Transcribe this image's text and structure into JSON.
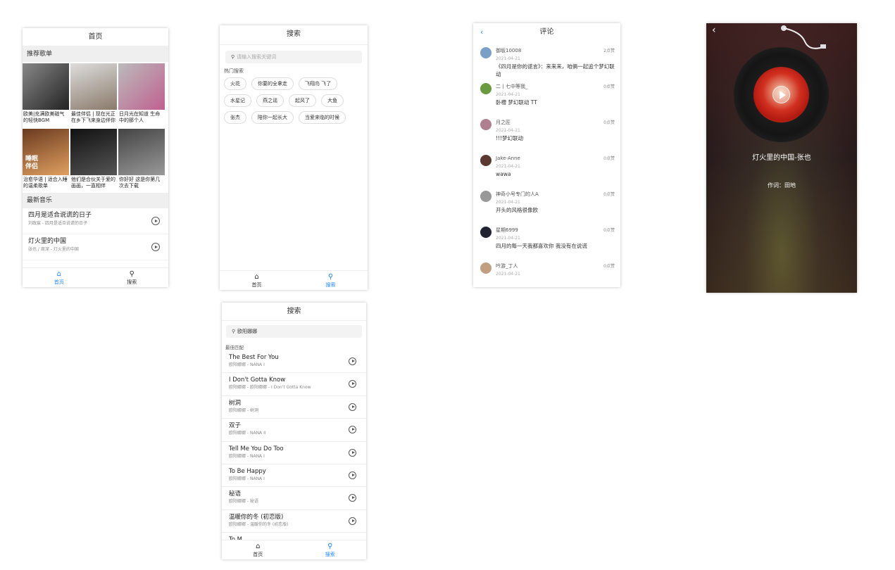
{
  "home": {
    "title": "首页",
    "rec_section": "推荐歌单",
    "playlists": [
      {
        "title": "欧美|充满欧美磁气的轻快BGM",
        "bg": "linear-gradient(135deg,#888,#222)"
      },
      {
        "title": "最佳伴侣 | 现在光正在乡下飞来身边伴你",
        "bg": "linear-gradient(160deg,#ddd,#8a7a6a)"
      },
      {
        "title": "日月光在知道 生命中的那个人",
        "bg": "linear-gradient(135deg,#bbb,#c06090)"
      },
      {
        "title": "治愈华语 | 适合入睡的温柔歌单",
        "bg": "linear-gradient(160deg,#6a3a20,#e0a060)",
        "overlay": "睡眠\n伴侣"
      },
      {
        "title": "他们是合伙关于爱的画画，一直相伴",
        "bg": "linear-gradient(160deg,#111,#555)"
      },
      {
        "title": "你好好 这是你第几次去下载",
        "bg": "linear-gradient(160deg,#444,#999)"
      }
    ],
    "latest_section": "最新音乐",
    "songs": [
      {
        "title": "四月是适合说谎的日子",
        "sub": "刘政宸 - 四月是适合说谎的日子"
      },
      {
        "title": "灯火里的中国",
        "sub": "张也 / 周深 - 灯火里的中国"
      }
    ]
  },
  "tabs": {
    "home": "首页",
    "search": "搜索"
  },
  "search": {
    "title": "搜索",
    "placeholder": "请输入搜索关键词",
    "hot_label": "热门搜索",
    "hot_words": [
      "火花",
      "你要的全拿走",
      "飞翔鸟 飞了",
      "水星记",
      "燕之谣",
      "起风了",
      "大鱼",
      "张杰",
      "陪你一起长大",
      "当爱来临的时候"
    ]
  },
  "comments": {
    "title": "评论",
    "items": [
      {
        "name": "御坂10008",
        "likes": "2点赞",
        "date": "2021-04-21",
        "text": "《四月是你的谎言》：来来来，咱俩一起追个梦幻联动",
        "color": "#7aa0c8"
      },
      {
        "name": "二丨七中等我_",
        "likes": "0点赞",
        "date": "2021-04-21",
        "text": "卧槽 梦幻联动 TT",
        "color": "#6a9a40"
      },
      {
        "name": "月之匠",
        "likes": "0点赞",
        "date": "2021-04-21",
        "text": "!!!梦幻联动",
        "color": "#b08090"
      },
      {
        "name": "Jake-Anne",
        "likes": "0点赞",
        "date": "2021-04-21",
        "text": "wawa",
        "color": "#5a3a30"
      },
      {
        "name": "神奇小号专门的人A",
        "likes": "0点赞",
        "date": "2021-04-21",
        "text": "开头的风格很像欧",
        "color": "#999"
      },
      {
        "name": "星期6999",
        "likes": "0点赞",
        "date": "2021-04-21",
        "text": "四月的每一天我都喜欢你 我没有在说谎",
        "color": "#223"
      },
      {
        "name": "吟游_丁人",
        "likes": "0点赞",
        "date": "2021-04-21",
        "text": "",
        "color": "#c0a080"
      }
    ]
  },
  "player": {
    "song_title": "灯火里的中国-张也",
    "lyric": "作词：田地"
  },
  "search_results": {
    "title": "搜索",
    "query": "欧阳娜娜",
    "best_label": "最佳匹配",
    "items": [
      {
        "title": "The Best For You",
        "sub": "欧阳娜娜 - NANA I"
      },
      {
        "title": "I Don't Gotta Know",
        "sub": "欧阳娜娜 - 欧阳娜娜 - I Don't Gotta Know"
      },
      {
        "title": "树洞",
        "sub": "欧阳娜娜 - 树洞"
      },
      {
        "title": "双子",
        "sub": "欧阳娜娜 - NANA II"
      },
      {
        "title": "Tell Me You Do Too",
        "sub": "欧阳娜娜 - NANA I"
      },
      {
        "title": "To Be Happy",
        "sub": "欧阳娜娜 - NANA I"
      },
      {
        "title": "秘语",
        "sub": "欧阳娜娜 - 秘语"
      },
      {
        "title": "温暖你的冬 (初恋版)",
        "sub": "欧阳娜娜 - 温暖你的冬 (初恋版)"
      },
      {
        "title": "To M...",
        "sub": ""
      }
    ]
  }
}
